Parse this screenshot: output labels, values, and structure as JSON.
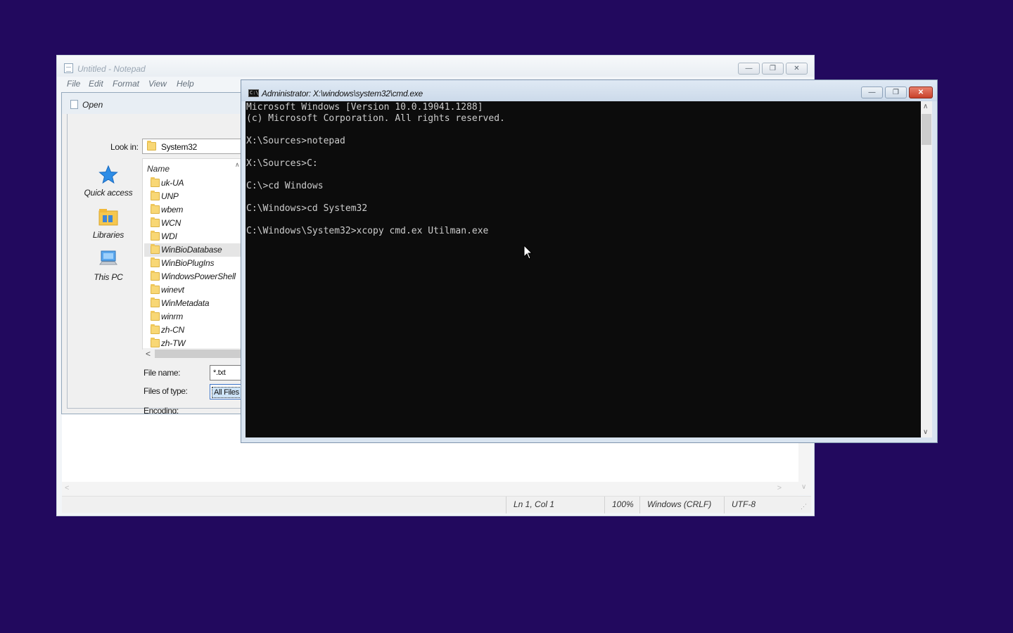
{
  "colors": {
    "desktop": "#22095e",
    "console_bg": "#0c0c0c",
    "console_text": "#cccccc",
    "close_red": "#c8412a"
  },
  "notepad": {
    "title": "Untitled - Notepad",
    "menu": [
      "File",
      "Edit",
      "Format",
      "View",
      "Help"
    ],
    "status": {
      "position": "Ln 1, Col 1",
      "zoom": "100%",
      "line_ending": "Windows (CRLF)",
      "encoding": "UTF-8"
    }
  },
  "open_dialog": {
    "title": "Open",
    "look_in_label": "Look in:",
    "look_in_value": "System32",
    "places": [
      {
        "label": "Quick access",
        "icon": "star-icon"
      },
      {
        "label": "Libraries",
        "icon": "libraries-folder-icon"
      },
      {
        "label": "This PC",
        "icon": "computer-icon"
      }
    ],
    "column_name": "Name",
    "folders": [
      "uk-UA",
      "UNP",
      "wbem",
      "WCN",
      "WDI",
      "WinBioDatabase",
      "WinBioPlugIns",
      "WindowsPowerShell",
      "winevt",
      "WinMetadata",
      "winrm",
      "zh-CN",
      "zh-TW"
    ],
    "selected_folder": "WinBioDatabase",
    "file_name_label": "File name:",
    "file_name_value": "*.txt",
    "files_of_type_label": "Files of type:",
    "files_of_type_value": "All Files",
    "encoding_label": "Encoding:"
  },
  "cmd": {
    "title": "Administrator: X:\\windows\\system32\\cmd.exe",
    "lines": [
      "Microsoft Windows [Version 10.0.19041.1288]",
      "(c) Microsoft Corporation. All rights reserved.",
      "",
      "X:\\Sources>notepad",
      "",
      "X:\\Sources>C:",
      "",
      "C:\\>cd Windows",
      "",
      "C:\\Windows>cd System32",
      "",
      "C:\\Windows\\System32>xcopy cmd.ex Utilman.exe"
    ]
  }
}
